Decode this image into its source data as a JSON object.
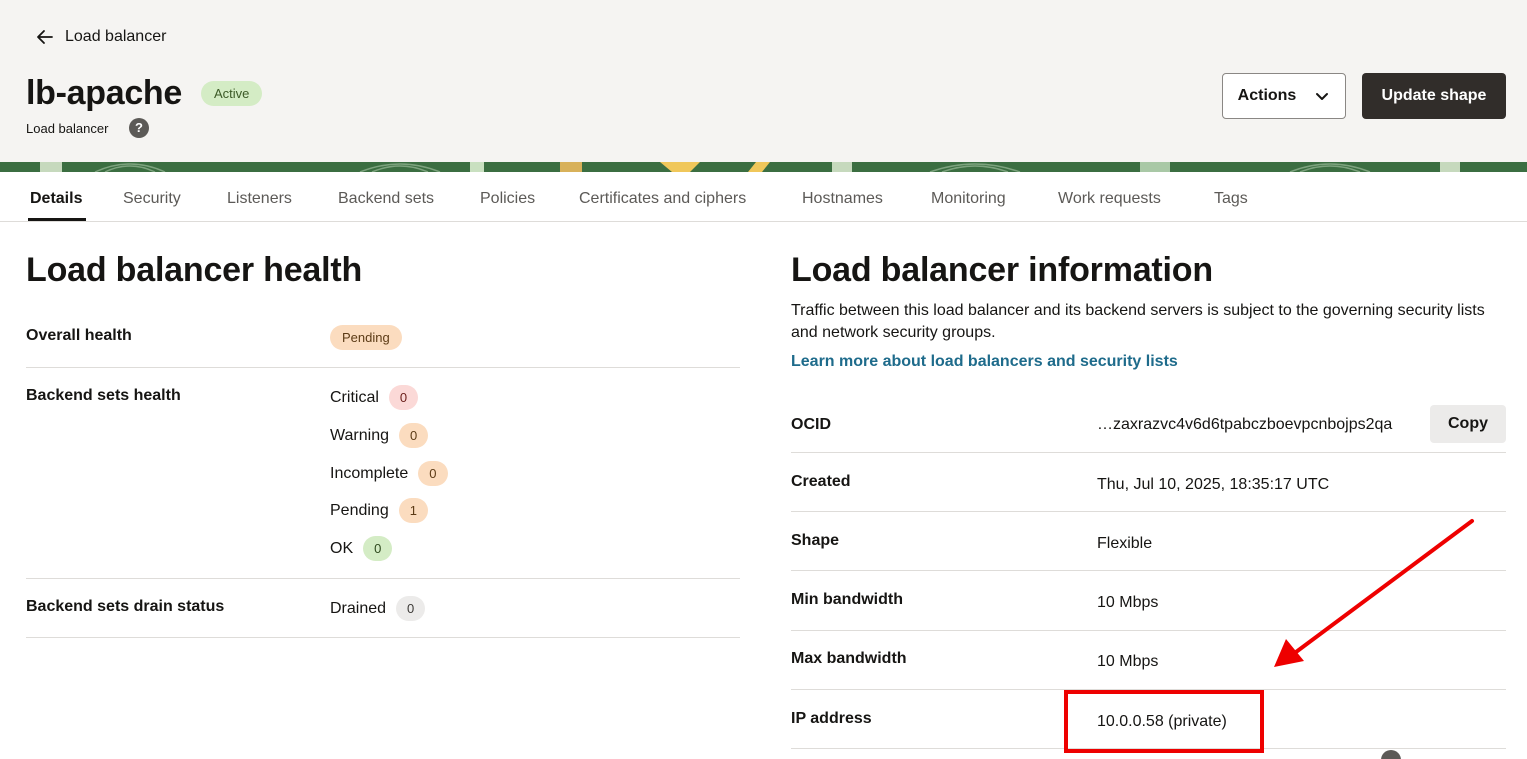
{
  "header": {
    "back_label": "Load balancer",
    "title": "lb-apache",
    "status": "Active",
    "subtitle": "Load balancer",
    "help": "?",
    "actions_label": "Actions",
    "update_label": "Update shape"
  },
  "tabs": [
    "Details",
    "Security",
    "Listeners",
    "Backend sets",
    "Policies",
    "Certificates and ciphers",
    "Hostnames",
    "Monitoring",
    "Work requests",
    "Tags"
  ],
  "health": {
    "title": "Load balancer health",
    "overall_label": "Overall health",
    "overall_value": "Pending",
    "backend_label": "Backend sets health",
    "counts": [
      {
        "label": "Critical",
        "value": "0"
      },
      {
        "label": "Warning",
        "value": "0"
      },
      {
        "label": "Incomplete",
        "value": "0"
      },
      {
        "label": "Pending",
        "value": "1"
      },
      {
        "label": "OK",
        "value": "0"
      }
    ],
    "drain_label": "Backend sets drain status",
    "drain_value": "Drained",
    "drain_count": "0"
  },
  "info": {
    "title": "Load balancer information",
    "description": "Traffic between this load balancer and its backend servers is subject to the governing security lists and network security groups.",
    "learn_more": "Learn more about load balancers and security lists",
    "rows": [
      {
        "label": "OCID",
        "value": "…zaxrazvc4v6d6tpabczboevpcnbojps2qa"
      },
      {
        "label": "Created",
        "value": "Thu, Jul 10, 2025, 18:35:17 UTC"
      },
      {
        "label": "Shape",
        "value": "Flexible"
      },
      {
        "label": "Min bandwidth",
        "value": "10 Mbps"
      },
      {
        "label": "Max bandwidth",
        "value": "10 Mbps"
      },
      {
        "label": "IP address",
        "value": "10.0.0.58 (private)"
      }
    ],
    "copy_label": "Copy"
  },
  "colors": {
    "accent_dark": "#312d2a",
    "link": "#1e6b8b",
    "annotation": "#ee0000"
  }
}
